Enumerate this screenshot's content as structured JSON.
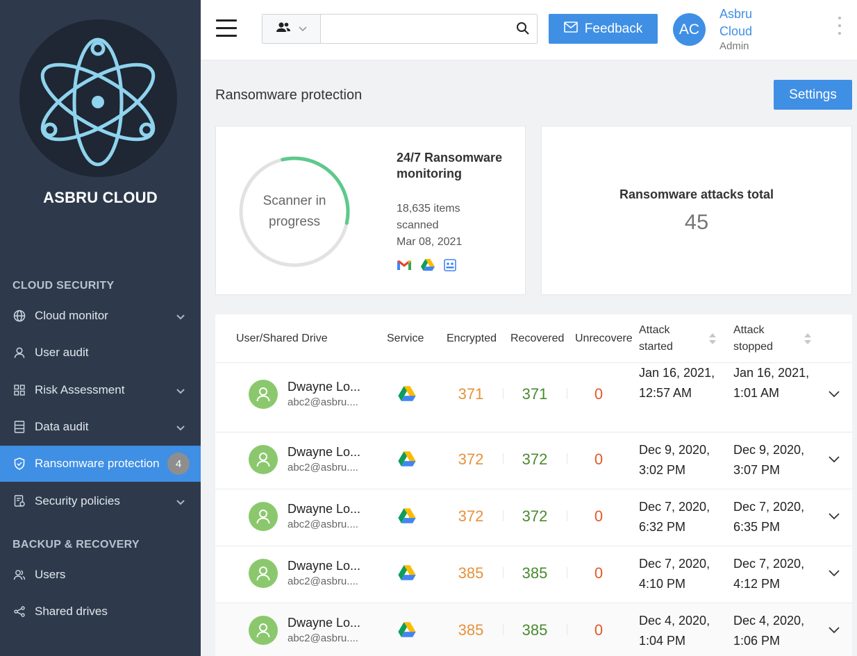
{
  "app": {
    "brand": "ASBRU CLOUD"
  },
  "sidebar": {
    "sections": [
      {
        "title": "CLOUD SECURITY"
      },
      {
        "title": "BACKUP & RECOVERY"
      }
    ],
    "items": [
      {
        "label": "Cloud monitor",
        "icon": "globe-icon"
      },
      {
        "label": "User audit",
        "icon": "user-icon"
      },
      {
        "label": "Risk Assessment",
        "icon": "grid-icon"
      },
      {
        "label": "Data audit",
        "icon": "database-icon"
      },
      {
        "label": "Ransomware protection",
        "icon": "shield-icon",
        "badge": "4"
      },
      {
        "label": "Security policies",
        "icon": "policy-icon"
      },
      {
        "label": "Users",
        "icon": "users-icon"
      },
      {
        "label": "Shared drives",
        "icon": "share-icon"
      }
    ]
  },
  "header": {
    "search_placeholder": "",
    "feedback_label": "Feedback",
    "avatar_initials": "AC",
    "user_name": "Asbru Cloud",
    "user_role": "Admin"
  },
  "page": {
    "title": "Ransomware protection",
    "settings_label": "Settings"
  },
  "scanner": {
    "status": "Scanner in progress",
    "progress": 0.32,
    "monitor_title": "24/7 Ransomware monitoring",
    "items_line1": "18,635 items",
    "items_line2": "scanned",
    "date": "Mar 08, 2021",
    "services": [
      "gmail-icon",
      "google-drive-icon",
      "contacts-icon"
    ]
  },
  "attacks": {
    "label": "Ransomware attacks total",
    "value": "45"
  },
  "table": {
    "columns": {
      "user": "User/Shared Drive",
      "service": "Service",
      "encrypted": "Encrypted",
      "recovered": "Recovered",
      "unrecovered": "Unrecovere",
      "attack_started_1": "Attack",
      "attack_started_2": "started",
      "attack_stopped_1": "Attack",
      "attack_stopped_2": "stopped"
    },
    "rows": [
      {
        "name": "Dwayne Lo...",
        "email": "abc2@asbru....",
        "encrypted": "371",
        "recovered": "371",
        "unrecovered": "0",
        "started": "Jan 16, 2021, 12:57 AM",
        "stopped": "Jan 16, 2021, 1:01 AM"
      },
      {
        "name": "Dwayne Lo...",
        "email": "abc2@asbru....",
        "encrypted": "372",
        "recovered": "372",
        "unrecovered": "0",
        "started": "Dec 9, 2020, 3:02 PM",
        "stopped": "Dec 9, 2020, 3:07 PM"
      },
      {
        "name": "Dwayne Lo...",
        "email": "abc2@asbru....",
        "encrypted": "372",
        "recovered": "372",
        "unrecovered": "0",
        "started": "Dec 7, 2020, 6:32 PM",
        "stopped": "Dec 7, 2020, 6:35 PM"
      },
      {
        "name": "Dwayne Lo...",
        "email": "abc2@asbru....",
        "encrypted": "385",
        "recovered": "385",
        "unrecovered": "0",
        "started": "Dec 7, 2020, 4:10 PM",
        "stopped": "Dec 7, 2020, 4:12 PM"
      },
      {
        "name": "Dwayne Lo...",
        "email": "abc2@asbru....",
        "encrypted": "385",
        "recovered": "385",
        "unrecovered": "0",
        "started": "Dec 4, 2020, 1:04 PM",
        "stopped": "Dec 4, 2020, 1:06 PM"
      }
    ]
  },
  "colors": {
    "accent": "#3f8fe5",
    "sidebar_bg": "#2e3a4c",
    "encrypted": "#e6913b",
    "recovered": "#4a8a2e",
    "unrecovered": "#e0592a",
    "avatar_green": "#8bc86d"
  }
}
